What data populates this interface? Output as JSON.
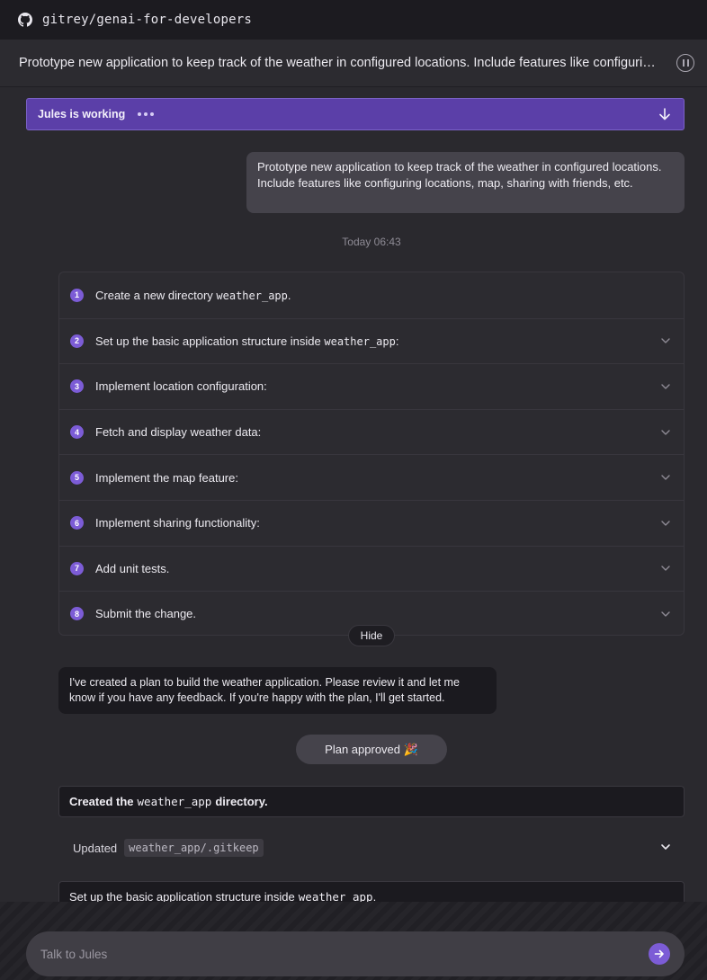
{
  "repo": {
    "name": "gitrey/genai-for-developers"
  },
  "task": {
    "title": "Prototype new application to keep track of the weather in configured locations. Include features like configuring locations, map, sharing with friends, etc."
  },
  "status": {
    "text": "Jules is working"
  },
  "user_message": "Prototype new application to keep track of the weather in configured locations. Include features like configuring locations, map, sharing with friends, etc.",
  "timestamp": "Today 06:43",
  "plan": {
    "steps": [
      {
        "num": "1",
        "text": "Create a new directory ",
        "code": "weather_app",
        "suffix": "."
      },
      {
        "num": "2",
        "text": "Set up the basic application structure inside ",
        "code": "weather_app",
        "suffix": ":"
      },
      {
        "num": "3",
        "text": "Implement location configuration:",
        "code": "",
        "suffix": ""
      },
      {
        "num": "4",
        "text": "Fetch and display weather data:",
        "code": "",
        "suffix": ""
      },
      {
        "num": "5",
        "text": "Implement the map feature:",
        "code": "",
        "suffix": ""
      },
      {
        "num": "6",
        "text": "Implement sharing functionality:",
        "code": "",
        "suffix": ""
      },
      {
        "num": "7",
        "text": "Add unit tests.",
        "code": "",
        "suffix": ""
      },
      {
        "num": "8",
        "text": "Submit the change.",
        "code": "",
        "suffix": ""
      }
    ],
    "hide_label": "Hide"
  },
  "agent_message": "I've created a plan to build the weather application. Please review it and let me know if you have any feedback. If you're happy with the plan, I'll get started.",
  "approved": {
    "label": "Plan approved",
    "emoji": "🎉"
  },
  "activity": {
    "created_prefix": "Created the",
    "created_code": "weather_app",
    "created_suffix": "directory.",
    "updated_label": "Updated",
    "updated_file": "weather_app/.gitkeep",
    "setup_prefix": "Set up the basic application structure inside",
    "setup_code": "weather_app",
    "setup_suffix": "."
  },
  "chat": {
    "placeholder": "Talk to Jules"
  },
  "colors": {
    "accent": "#7c5cd6",
    "banner": "#5b3fa8"
  }
}
